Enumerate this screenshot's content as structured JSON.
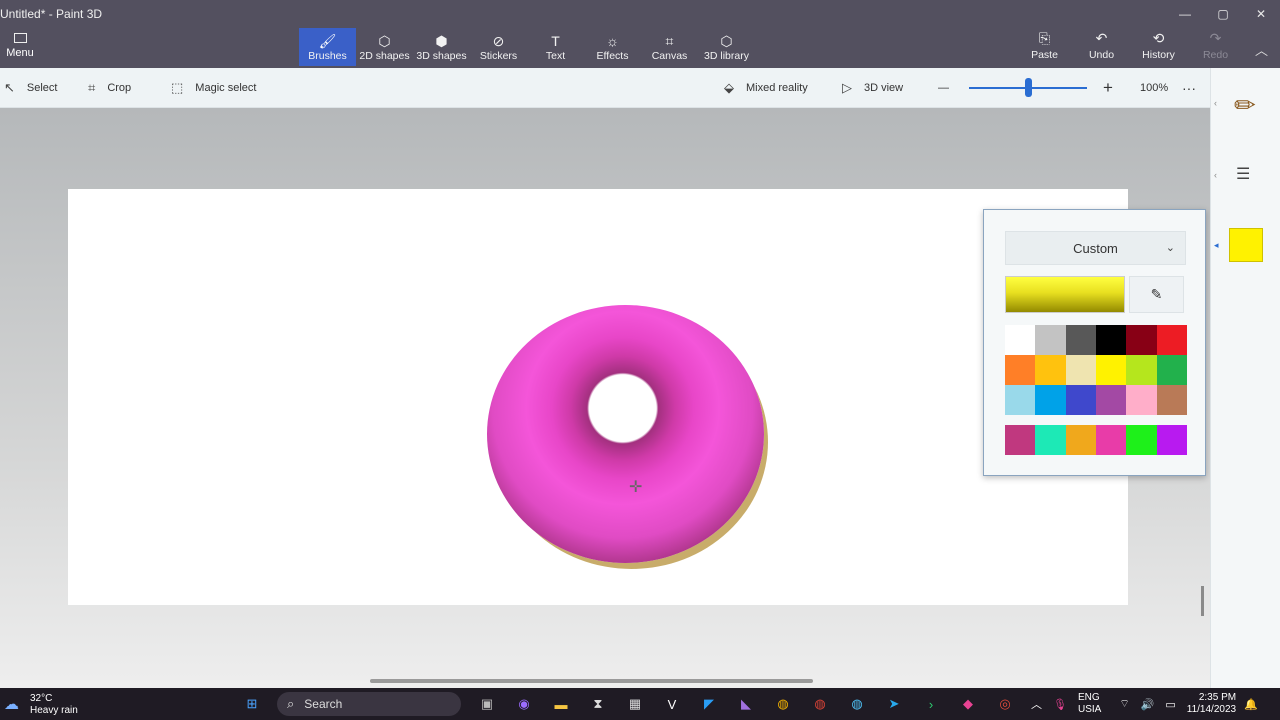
{
  "window": {
    "title": "Untitled* - Paint 3D",
    "minimize": "—",
    "maximize": "▢",
    "close": "✕"
  },
  "ribbon": {
    "menu_label": "Menu",
    "tools": [
      {
        "label": "Brushes",
        "icon": "brush-icon",
        "glyph": "🖌"
      },
      {
        "label": "2D shapes",
        "icon": "2d-shapes-icon",
        "glyph": "⬡"
      },
      {
        "label": "3D shapes",
        "icon": "3d-shapes-icon",
        "glyph": "⬢"
      },
      {
        "label": "Stickers",
        "icon": "sticker-icon",
        "glyph": "⊘"
      },
      {
        "label": "Text",
        "icon": "text-icon",
        "glyph": "T"
      },
      {
        "label": "Effects",
        "icon": "effects-icon",
        "glyph": "☼"
      },
      {
        "label": "Canvas",
        "icon": "canvas-icon",
        "glyph": "⌗"
      },
      {
        "label": "3D library",
        "icon": "3d-library-icon",
        "glyph": "⬡"
      }
    ],
    "active_tool": "Brushes",
    "paste": "Paste",
    "undo": "Undo",
    "history": "History",
    "redo": "Redo"
  },
  "subbar": {
    "select": "Select",
    "crop": "Crop",
    "magic_select": "Magic select",
    "mixed_reality": "Mixed reality",
    "view_3d": "3D view",
    "zoom_out": "—",
    "zoom_in": "+",
    "zoom_level": "100%",
    "more": "···"
  },
  "zoom": {
    "level_percent": 100
  },
  "color_picker": {
    "dropdown_value": "Custom",
    "current_color": "#f4e600",
    "palette": [
      "#ffffff",
      "#c3c3c3",
      "#585858",
      "#000000",
      "#880015",
      "#ed1c24",
      "#ff7f27",
      "#ffc20e",
      "#efe4b0",
      "#fff200",
      "#b5e61d",
      "#22b14c",
      "#99d9ea",
      "#00a2e8",
      "#3f48cc",
      "#a349a4",
      "#ffaec9",
      "#b97a57"
    ],
    "custom_colors": [
      "#c0387f",
      "#1de9b6",
      "#f0a81c",
      "#e83ca8",
      "#1ef01a",
      "#b81af0"
    ]
  },
  "side_panel": {
    "selected_color": "#fff200"
  },
  "taskbar": {
    "temperature": "32°C",
    "weather": "Heavy rain",
    "search_placeholder": "Search",
    "lang": "ENG",
    "region": "USIA",
    "time": "2:35 PM",
    "date": "11/14/2023",
    "notification_badge": "1"
  }
}
